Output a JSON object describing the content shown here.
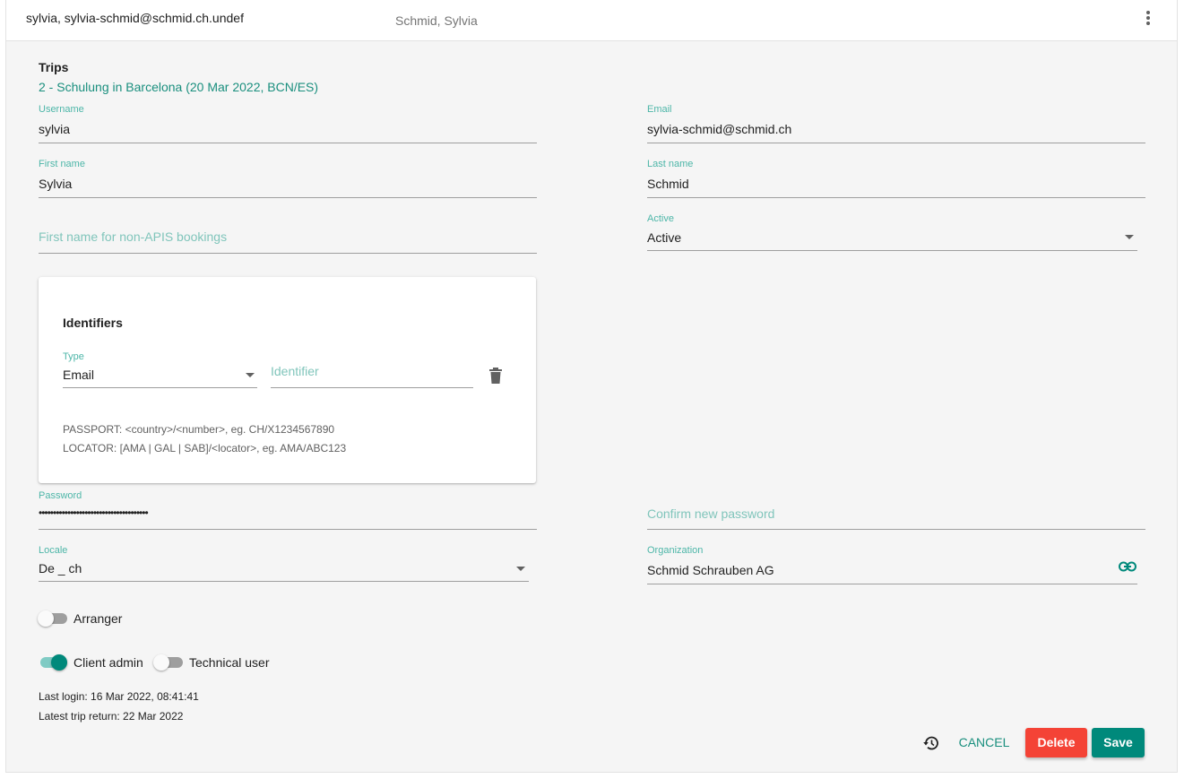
{
  "header": {
    "title": "sylvia, sylvia-schmid@schmid.ch.undef",
    "subtitle": "Schmid, Sylvia",
    "menu_icon": "more-vert-icon"
  },
  "trips": {
    "title": "Trips",
    "link": "2 - Schulung in Barcelona (20 Mar 2022, BCN/ES)"
  },
  "fields": {
    "username": {
      "label": "Username",
      "value": "sylvia"
    },
    "email": {
      "label": "Email",
      "value": "sylvia-schmid@schmid.ch"
    },
    "first_name": {
      "label": "First name",
      "value": "Sylvia"
    },
    "last_name": {
      "label": "Last name",
      "value": "Schmid"
    },
    "first_name_non_apis": {
      "placeholder": "First name for non-APIS bookings"
    },
    "active": {
      "label": "Active",
      "value": "Active"
    },
    "password": {
      "label": "Password",
      "value": "••••••••••••••••••••••••••••••••••••••"
    },
    "confirm_password": {
      "placeholder": "Confirm new password"
    },
    "locale": {
      "label": "Locale",
      "value": "De _ ch"
    },
    "organization": {
      "label": "Organization",
      "value": "Schmid Schrauben AG",
      "icon": "link-icon"
    }
  },
  "identifiers": {
    "title": "Identifiers",
    "type_label": "Type",
    "type_value": "Email",
    "identifier_placeholder": "Identifier",
    "delete_icon": "trash-icon",
    "hint_passport": "PASSPORT: <country>/<number>, eg. CH/X1234567890",
    "hint_locator": "LOCATOR: [AMA | GAL | SAB]/<locator>, eg. AMA/ABC123"
  },
  "toggles": {
    "arranger": {
      "label": "Arranger",
      "on": false
    },
    "client_admin": {
      "label": "Client admin",
      "on": true
    },
    "technical_user": {
      "label": "Technical user",
      "on": false
    }
  },
  "meta": {
    "last_login": "Last login: 16 Mar 2022, 08:41:41",
    "latest_trip_return": "Latest trip return: 22 Mar 2022"
  },
  "actions": {
    "history_icon": "history-icon",
    "cancel": "CANCEL",
    "delete": "Delete",
    "save": "Save"
  },
  "colors": {
    "accent": "#00897b",
    "danger": "#f44336",
    "label": "#4db6a8"
  }
}
